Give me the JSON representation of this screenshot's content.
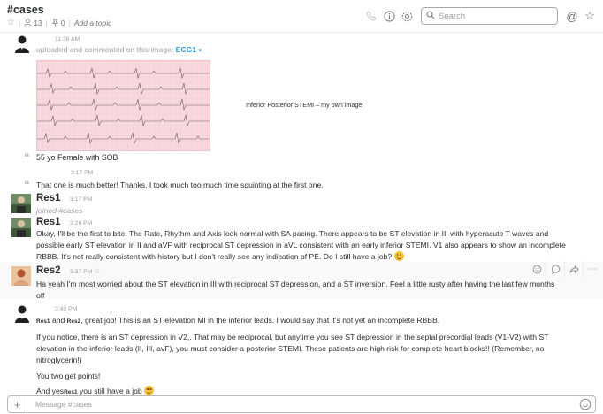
{
  "header": {
    "channel_name": "#cases",
    "members_count": "13",
    "pins_count": "0",
    "add_topic": "Add a topic",
    "search_placeholder": "Search",
    "at_symbol": "@"
  },
  "messages": [
    {
      "id": "m1",
      "time": "11:38 AM",
      "action_prefix": "uploaded and commented on this image:",
      "file_name": "ECG1",
      "image_caption": "Inferior Posterior STEMI – my own image",
      "comment": "55 yo Female with SOB"
    },
    {
      "id": "m2",
      "time": "3:17 PM",
      "text": "That one is much better! Thanks, I took much too much time squinting at the first one."
    },
    {
      "id": "m3",
      "user": "Res1",
      "time": "3:17 PM",
      "text": "joined #cases"
    },
    {
      "id": "m4",
      "user": "Res1",
      "time": "3:26 PM",
      "line1": "Okay, I'll be the first to bite. The Rate, Rhythm and Axis look normal with SA pacing. There appears to be ST elevation in III with hyperacute T waves and",
      "line2": "possible early ST elevation in II and aVF with reciprocal ST depression in aVL consistent with an early inferior STEMI. V1 also appears to show an incomplete",
      "line3": "RBBB.  It's not really consistent with history but I don't really see any indication of PE.  Do I still have a job?"
    },
    {
      "id": "m5",
      "user": "Res2",
      "time": "3:37 PM",
      "line1": "Ha yeah I'm most worried about the ST elevation in III with reciprocal ST depression, and a ST inversion. Feel a little rusty after having the last few months",
      "line2": "off"
    },
    {
      "id": "m6",
      "time": "3:40 PM",
      "mention1": "Res1",
      "and": "and",
      "mention2": "Res2",
      "line1_rest": ", great job! This is an ST elevation MI in the inferior leads. I would say that it's not yet an incomplete RBBB.",
      "para2_line1": "If you notice, there is an ST depression in V2,. That may be reciprocal, but anytime you see ST depression in the septal precordial leads (V1-V2) with ST",
      "para2_line2": "elevation in the inferior leads (II, III, avF), you must consider a posterior STEMI. These patients are high risk for complete heart blocks!! (Remember, no",
      "para2_line3": "nitroglycerin!)",
      "para3": "You two get points!",
      "para4_prefix": "And yes",
      "para4_mention": "Res1",
      "para4_rest": " you still have a job"
    }
  ],
  "composer": {
    "placeholder": "Message #cases",
    "plus": "+"
  },
  "colors": {
    "link": "#2d9ee0",
    "ecg_background": "#f8d9df",
    "emoji": "#f5c23a"
  }
}
